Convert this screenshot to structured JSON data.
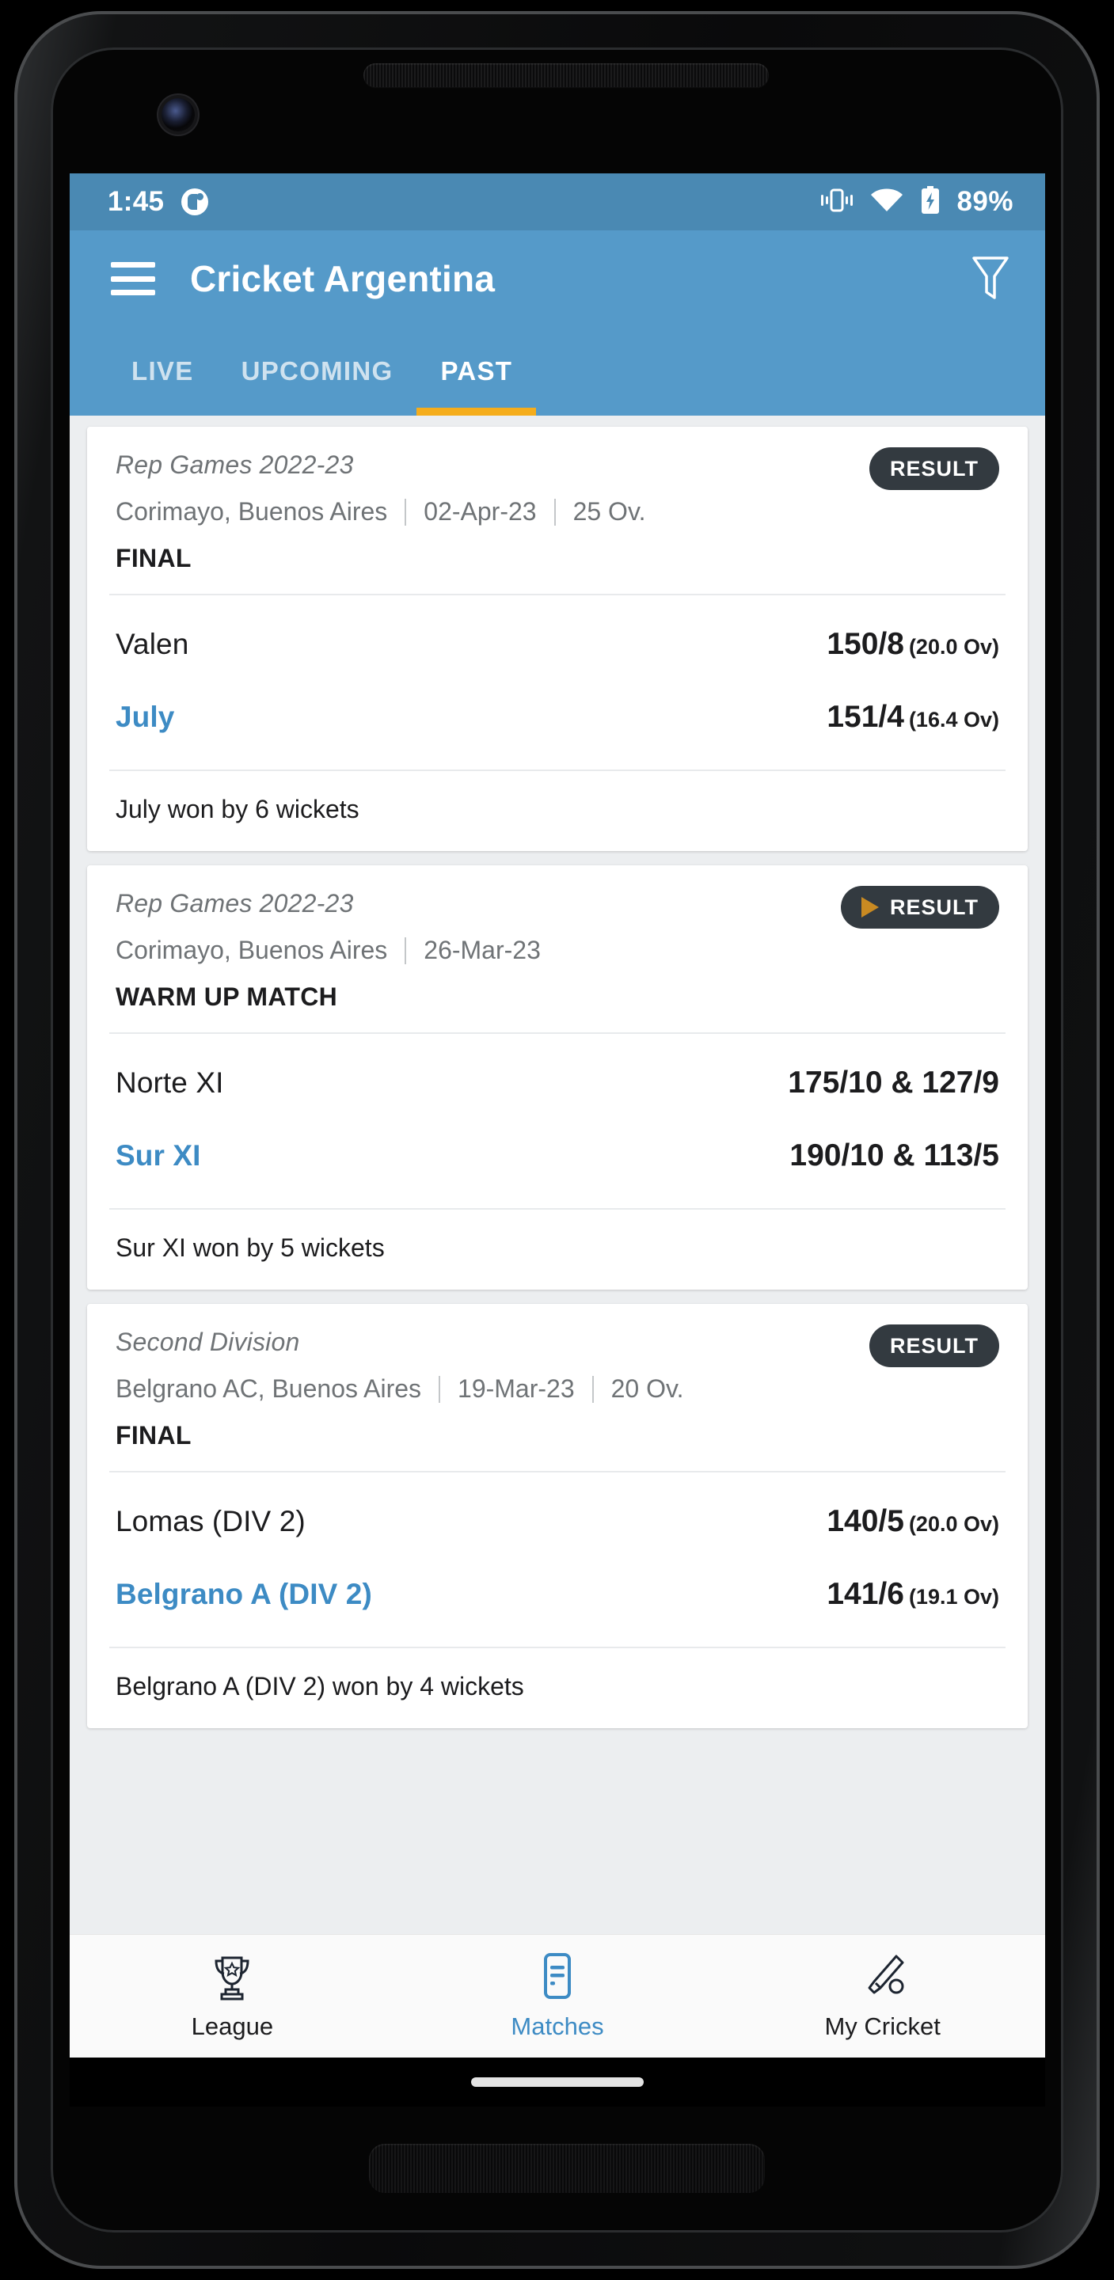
{
  "status_bar": {
    "time": "1:45",
    "battery_percent": "89%",
    "icons": [
      "notification-dot-icon",
      "vibrate-icon",
      "wifi-icon",
      "battery-charging-icon"
    ]
  },
  "app_bar": {
    "menu_icon": "hamburger-menu-icon",
    "title": "Cricket Argentina",
    "filter_icon": "filter-funnel-icon"
  },
  "tabs": [
    {
      "label": "LIVE",
      "active": false
    },
    {
      "label": "UPCOMING",
      "active": false
    },
    {
      "label": "PAST",
      "active": true
    }
  ],
  "theme": {
    "status_bar_blue": "#4a89b3",
    "app_bar_blue": "#559ac9",
    "tab_indicator_yellow": "#f5ad1c",
    "accent_blue": "#3d8bc4",
    "badge_dark": "#333a40",
    "play_gold": "#c98a22",
    "page_bg": "#eceef0"
  },
  "matches": [
    {
      "series": "Rep Games 2022-23",
      "venue": "Corimayo, Buenos Aires",
      "date": "02-Apr-23",
      "overs": "25 Ov.",
      "match_type": "FINAL",
      "badge_label": "RESULT",
      "badge_has_play_icon": false,
      "teams": [
        {
          "name": "Valen",
          "score": "150/8",
          "overs": "(20.0 Ov)",
          "winner": false
        },
        {
          "name": "July",
          "score": "151/4",
          "overs": "(16.4 Ov)",
          "winner": true
        }
      ],
      "result_text": "July won by 6 wickets"
    },
    {
      "series": "Rep Games 2022-23",
      "venue": "Corimayo, Buenos Aires",
      "date": "26-Mar-23",
      "overs": "",
      "match_type": "WARM UP MATCH",
      "badge_label": "RESULT",
      "badge_has_play_icon": true,
      "teams": [
        {
          "name": "Norte XI",
          "score": "175/10 & 127/9",
          "overs": "",
          "winner": false
        },
        {
          "name": "Sur XI",
          "score": "190/10 & 113/5",
          "overs": "",
          "winner": true
        }
      ],
      "result_text": "Sur XI won by 5 wickets"
    },
    {
      "series": "Second Division",
      "venue": "Belgrano AC, Buenos Aires",
      "date": "19-Mar-23",
      "overs": "20 Ov.",
      "match_type": "FINAL",
      "badge_label": "RESULT",
      "badge_has_play_icon": false,
      "teams": [
        {
          "name": "Lomas (DIV 2)",
          "score": "140/5",
          "overs": "(20.0 Ov)",
          "winner": false
        },
        {
          "name": "Belgrano A (DIV 2)",
          "score": "141/6",
          "overs": "(19.1 Ov)",
          "winner": true
        }
      ],
      "result_text": "Belgrano A (DIV 2) won by 4 wickets"
    }
  ],
  "bottom_nav": [
    {
      "label": "League",
      "icon": "trophy-icon",
      "active": false
    },
    {
      "label": "Matches",
      "icon": "matches-list-icon",
      "active": true
    },
    {
      "label": "My Cricket",
      "icon": "cricket-bat-ball-icon",
      "active": false
    }
  ]
}
